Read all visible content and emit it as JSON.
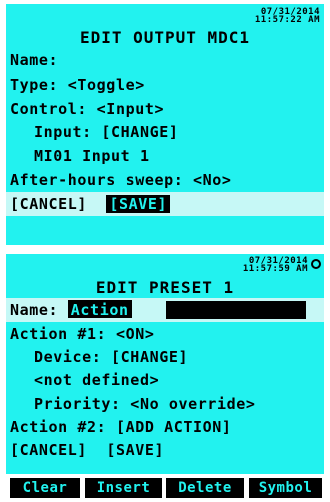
{
  "screen1": {
    "date": "07/31/2014",
    "time": "11:57:22 AM",
    "title": "EDIT OUTPUT MDC1",
    "name_label": "Name:",
    "type_line": "Type: <Toggle>",
    "control_line": "Control: <Input>",
    "input_line": "Input: [CHANGE]",
    "input_value": "MI01 Input 1",
    "sweep_line": "After-hours sweep: <No>",
    "cancel": "[CANCEL]",
    "save": "[SAVE]"
  },
  "screen2": {
    "date": "07/31/2014",
    "time": "11:57:59 AM",
    "title": "EDIT PRESET 1",
    "name_label": "Name:",
    "name_value": "Action",
    "action1_line": "Action #1: <ON>",
    "device_line": "Device: [CHANGE]",
    "not_defined": "<not defined>",
    "priority_line": "Priority: <No override>",
    "action2_line": "Action #2: [ADD ACTION]",
    "cancel": "[CANCEL]",
    "save": "[SAVE]",
    "softkeys": [
      "Clear",
      "Insert",
      "Delete",
      "Symbol"
    ]
  }
}
